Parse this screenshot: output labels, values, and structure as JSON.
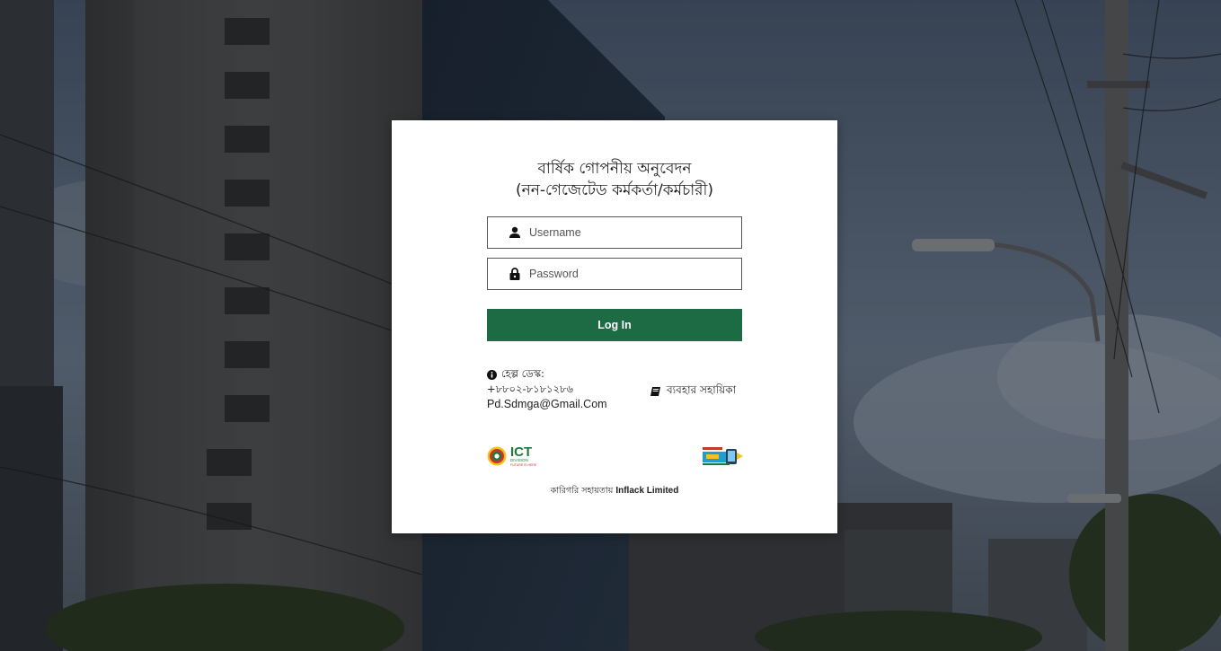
{
  "header": {
    "title_line1": "বার্ষিক গোপনীয় অনুবেদন",
    "title_line2": "(নন-গেজেটেড কর্মকর্তা/কর্মচারী)"
  },
  "form": {
    "username_placeholder": "Username",
    "password_placeholder": "Password",
    "login_label": "Log In",
    "username_icon": "user-icon",
    "password_icon": "lock-icon"
  },
  "help": {
    "label": "হেল্প ডেস্ক:",
    "phone": "+৮৮০২-৮১৮১২৮৬",
    "email": "Pd.Sdmga@Gmail.Com",
    "icon": "info-icon"
  },
  "guide": {
    "label": "ব্যবহার সহায়িকা",
    "icon": "book-icon"
  },
  "logos": {
    "ict_name": "ICT",
    "ict_sub": "DIVISION",
    "ict_tagline": "FUTURE IS HERE"
  },
  "footer": {
    "credit_prefix": "কারিগরি সহায়তায়",
    "credit_company": "Inflack Limited"
  },
  "colors": {
    "primary": "#1d6b45",
    "card_bg": "#ffffff",
    "text": "#222222"
  }
}
